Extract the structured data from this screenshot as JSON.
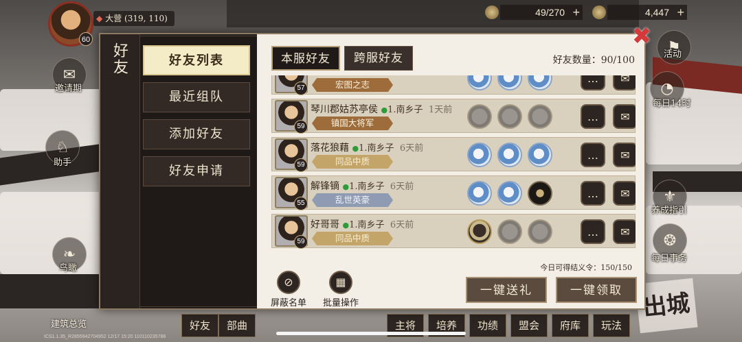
{
  "hud": {
    "player_level": "60",
    "location": "大营 (319, 110)",
    "resource1": "49/270",
    "resource2": "4,447",
    "version": "ICS1.1.35_R2855942704952 12/17 15:20 110110235788",
    "build_overview": "建筑总览",
    "chu_cheng": "出城"
  },
  "side_left": [
    {
      "label": "邀请期",
      "icon": "invite-icon"
    },
    {
      "label": "助手",
      "icon": "helper-icon"
    },
    {
      "label": "鸟瞰",
      "icon": "bird-icon"
    }
  ],
  "side_right": [
    {
      "label": "活动",
      "icon": "event-icon"
    },
    {
      "label": "每日14时",
      "icon": "clock-icon"
    },
    {
      "label": "养成指引",
      "icon": "guide-icon"
    },
    {
      "label": "每日事务",
      "icon": "daily-icon"
    }
  ],
  "bottom_tabs": [
    "好友",
    "部曲",
    "主将",
    "培养",
    "功绩",
    "盟会",
    "府库",
    "玩法"
  ],
  "dialog": {
    "title": "好友",
    "side_tabs": [
      {
        "label": "好友列表",
        "active": true
      },
      {
        "label": "最近组队",
        "active": false
      },
      {
        "label": "添加好友",
        "active": false
      },
      {
        "label": "好友申请",
        "active": false
      }
    ],
    "server_tabs": [
      {
        "label": "本服好友",
        "active": true
      },
      {
        "label": "跨服好友",
        "active": false
      }
    ],
    "friend_count_label": "好友数量：",
    "friend_count": "90/100",
    "friends": [
      {
        "name": "",
        "level": "57",
        "title": "宏图之志",
        "server": "",
        "ago": "",
        "slots": [
          "filled",
          "filled",
          "filled"
        ]
      },
      {
        "name": "琴川郡姑苏亭侯",
        "level": "59",
        "title": "镇国大将军",
        "server": "1.南乡子",
        "ago": "1天前",
        "slots": [
          "empty",
          "empty",
          "empty"
        ]
      },
      {
        "name": "落花狼藉",
        "level": "59",
        "title": "同品中质",
        "server": "1.南乡子",
        "ago": "6天前",
        "slots": [
          "filled",
          "filled",
          "filled"
        ]
      },
      {
        "name": "解锋镝",
        "level": "55",
        "title": "乱世英豪",
        "server": "1.南乡子",
        "ago": "6天前",
        "slots": [
          "filled",
          "filled",
          "black"
        ]
      },
      {
        "name": "好哥哥",
        "level": "59",
        "title": "同品中质",
        "server": "1.南乡子",
        "ago": "6天前",
        "slots": [
          "dark",
          "empty",
          "empty"
        ]
      }
    ],
    "quota_label": "今日可得结义令：",
    "quota": "150/150",
    "blacklist_label": "屏蔽名单",
    "batch_label": "批量操作",
    "send_all_label": "一键送礼",
    "claim_all_label": "一键领取",
    "close_icon": "close-icon"
  }
}
